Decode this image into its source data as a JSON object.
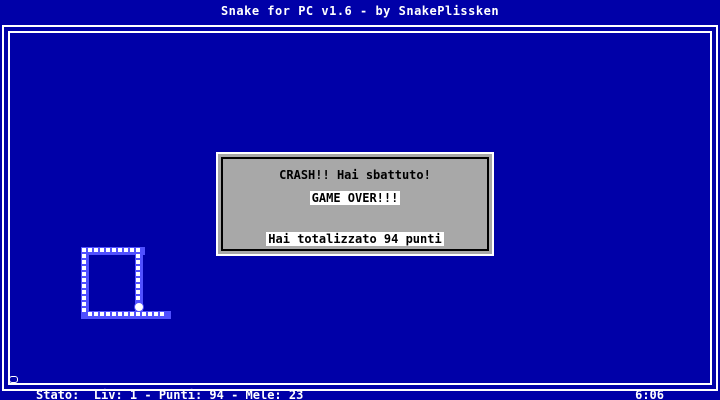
{
  "window": {
    "title": "Snake for PC v1.6 - by SnakePlissken"
  },
  "dialog": {
    "crash_text": "CRASH!!  Hai sbattuto!",
    "game_over_text": "GAME OVER!!!",
    "score_text": "Hai totalizzato 94 punti"
  },
  "status_bar": {
    "left_text": "Stato:  Liv: 1 - Punti: 94 - Mele: 23",
    "time": "6:06"
  },
  "colors": {
    "background": "#0000a8",
    "dialog_bg": "#a8a8a8",
    "snake_body": "#5050ff",
    "snake_dots": "#ffffff",
    "text": "#ffffff"
  },
  "icons": {
    "snake_head": "snake-head-icon",
    "marker": "life-marker-icon"
  }
}
